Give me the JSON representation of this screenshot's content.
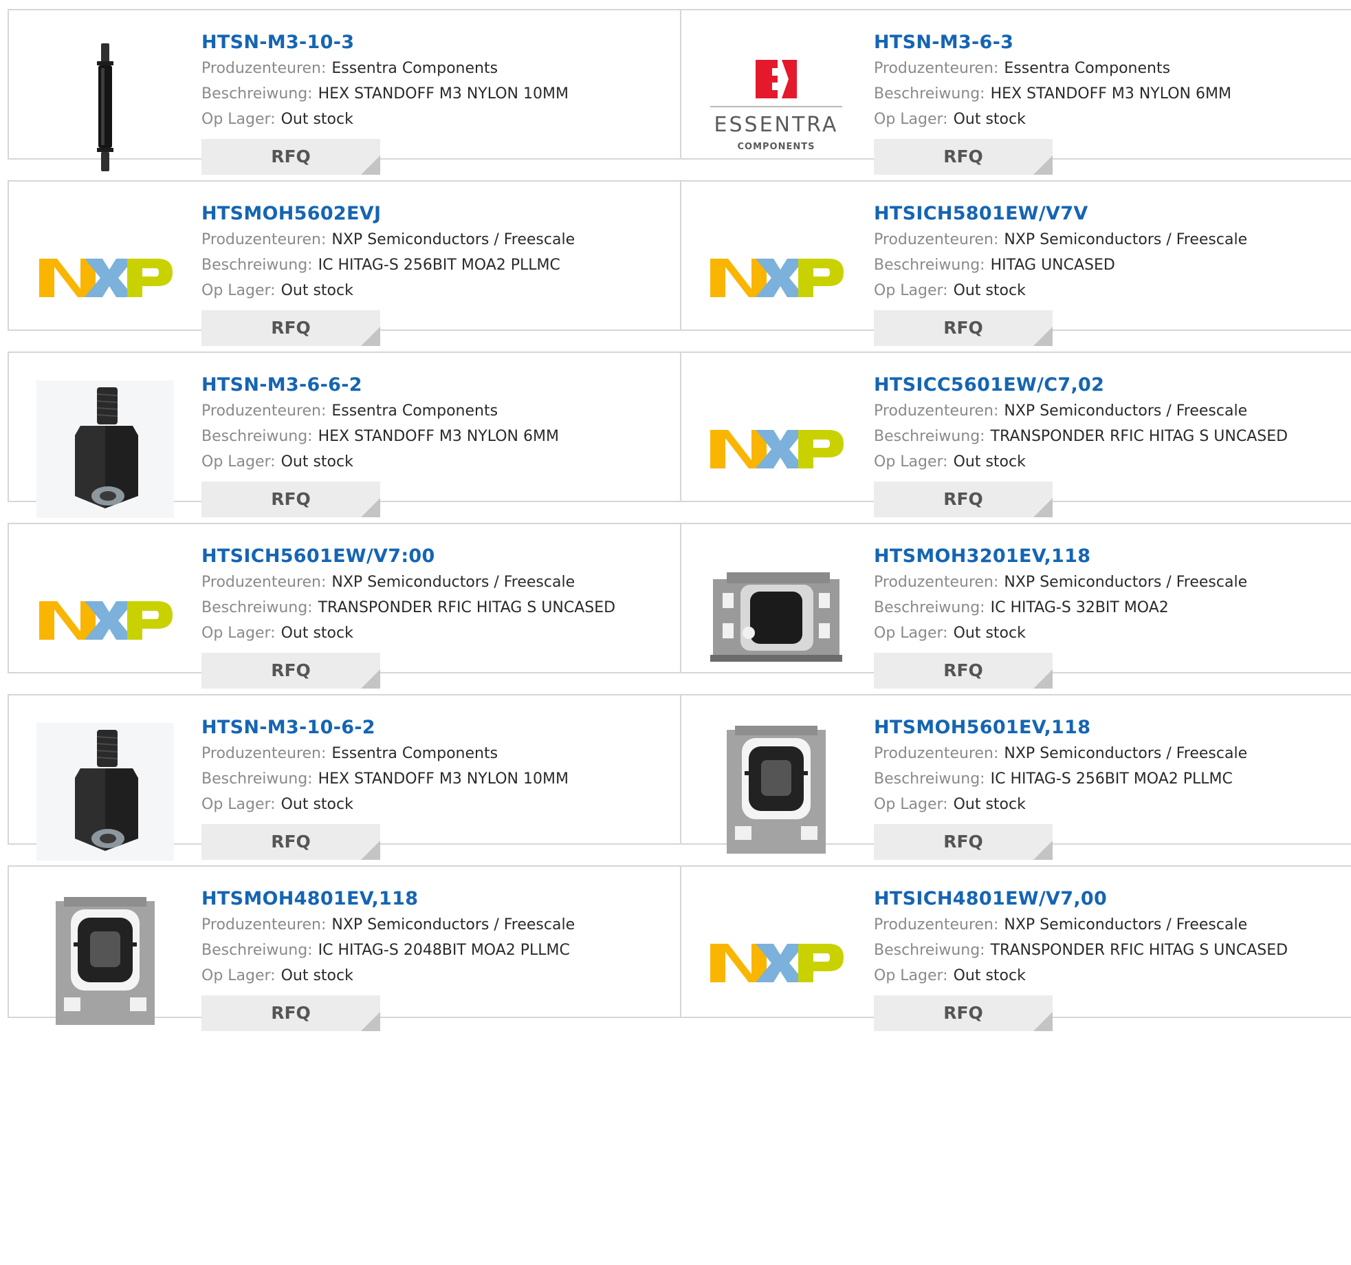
{
  "labels": {
    "manufacturer": "Produzenteuren:",
    "description": "Beschreiwung:",
    "stock": "Op Lager:",
    "rfq": "RFQ"
  },
  "logo_text": {
    "essentra_name": "ESSENTRA",
    "essentra_sub": "COMPONENTS",
    "essentra_mark": "E"
  },
  "colors": {
    "title": "#1565b3",
    "border": "#d6d6d6",
    "rfq_bg": "#ececec",
    "nxp_orange": "#f9b500",
    "nxp_blue": "#7bb1db",
    "nxp_green": "#c9d200",
    "essentra_red": "#e4192c"
  },
  "products": [
    {
      "pn": "HTSN-M3-10-3",
      "manufacturer": "Essentra Components",
      "description": "HEX STANDOFF M3 NYLON 10MM",
      "stock": "Out stock",
      "image": "standoff-pin"
    },
    {
      "pn": "HTSN-M3-6-3",
      "manufacturer": "Essentra Components",
      "description": "HEX STANDOFF M3 NYLON 6MM",
      "stock": "Out stock",
      "image": "essentra-logo"
    },
    {
      "pn": "HTSMOH5602EVJ",
      "manufacturer": "NXP Semiconductors / Freescale",
      "description": "IC HITAG-S 256BIT MOA2 PLLMC",
      "stock": "Out stock",
      "image": "nxp-logo"
    },
    {
      "pn": "HTSICH5801EW/V7V",
      "manufacturer": "NXP Semiconductors / Freescale",
      "description": "HITAG UNCASED",
      "stock": "Out stock",
      "image": "nxp-logo"
    },
    {
      "pn": "HTSN-M3-6-6-2",
      "manufacturer": "Essentra Components",
      "description": "HEX STANDOFF M3 NYLON 6MM",
      "stock": "Out stock",
      "image": "standoff-hex"
    },
    {
      "pn": "HTSICC5601EW/C7,02",
      "manufacturer": "NXP Semiconductors / Freescale",
      "description": "TRANSPONDER RFIC HITAG S UNCASED",
      "stock": "Out stock",
      "image": "nxp-logo"
    },
    {
      "pn": "HTSICH5601EW/V7:00",
      "manufacturer": "NXP Semiconductors / Freescale",
      "description": "TRANSPONDER RFIC HITAG S UNCASED",
      "stock": "Out stock",
      "image": "nxp-logo"
    },
    {
      "pn": "HTSMOH3201EV,118",
      "manufacturer": "NXP Semiconductors / Freescale",
      "description": "IC HITAG-S 32BIT MOA2",
      "stock": "Out stock",
      "image": "module-wide"
    },
    {
      "pn": "HTSN-M3-10-6-2",
      "manufacturer": "Essentra Components",
      "description": "HEX STANDOFF M3 NYLON 10MM",
      "stock": "Out stock",
      "image": "standoff-hex"
    },
    {
      "pn": "HTSMOH5601EV,118",
      "manufacturer": "NXP Semiconductors / Freescale",
      "description": "IC HITAG-S 256BIT MOA2 PLLMC",
      "stock": "Out stock",
      "image": "module-tall"
    },
    {
      "pn": "HTSMOH4801EV,118",
      "manufacturer": "NXP Semiconductors / Freescale",
      "description": "IC HITAG-S 2048BIT MOA2 PLLMC",
      "stock": "Out stock",
      "image": "module-tall"
    },
    {
      "pn": "HTSICH4801EW/V7,00",
      "manufacturer": "NXP Semiconductors / Freescale",
      "description": "TRANSPONDER RFIC HITAG S UNCASED",
      "stock": "Out stock",
      "image": "nxp-logo"
    }
  ]
}
